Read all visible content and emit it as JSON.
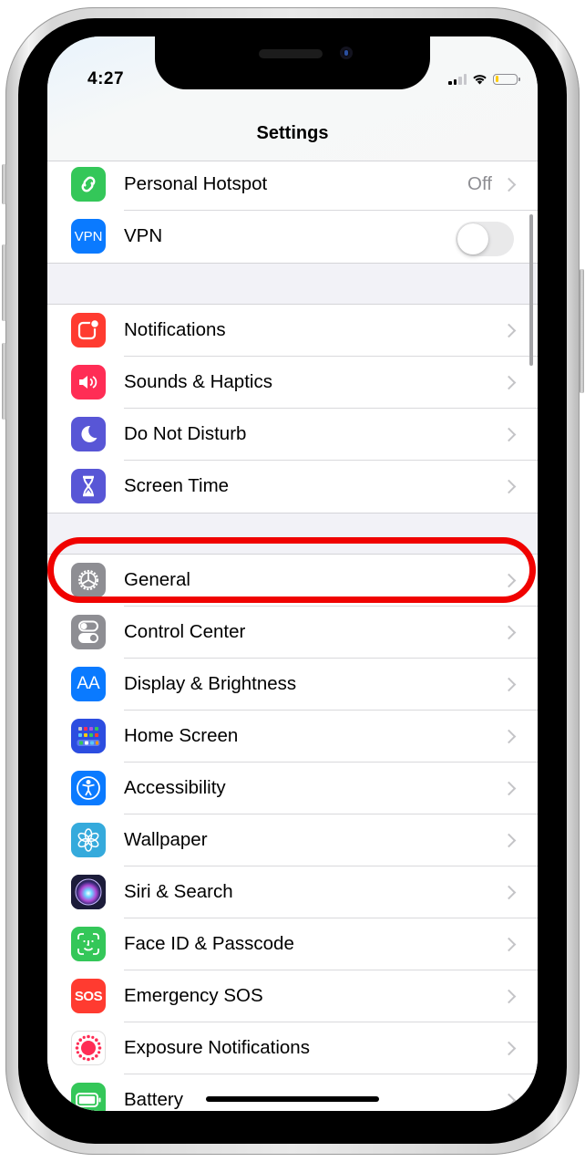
{
  "status_bar": {
    "time": "4:27",
    "signal_bars_active": 2,
    "signal_bars_total": 4,
    "wifi": "connected",
    "battery_level_percent": 15,
    "battery_color": "#ffcc00"
  },
  "nav": {
    "title": "Settings"
  },
  "groups": [
    {
      "rows": [
        {
          "label": "Personal Hotspot",
          "icon": "personal-hotspot-icon",
          "icon_color": "#34c759",
          "value": "Off",
          "accessory": "chevron"
        },
        {
          "label": "VPN",
          "icon": "vpn-icon",
          "icon_color": "#0a7aff",
          "icon_text": "VPN",
          "accessory": "toggle",
          "toggle_on": false
        }
      ]
    },
    {
      "rows": [
        {
          "label": "Notifications",
          "icon": "notifications-icon",
          "icon_color": "#ff3b30",
          "accessory": "chevron"
        },
        {
          "label": "Sounds & Haptics",
          "icon": "speaker-icon",
          "icon_color": "#ff2d55",
          "accessory": "chevron"
        },
        {
          "label": "Do Not Disturb",
          "icon": "moon-icon",
          "icon_color": "#5856d6",
          "accessory": "chevron"
        },
        {
          "label": "Screen Time",
          "icon": "hourglass-icon",
          "icon_color": "#5856d6",
          "accessory": "chevron"
        }
      ]
    },
    {
      "rows": [
        {
          "label": "General",
          "icon": "gear-icon",
          "icon_color": "#8e8e93",
          "accessory": "chevron",
          "highlighted": true
        },
        {
          "label": "Control Center",
          "icon": "switches-icon",
          "icon_color": "#8e8e93",
          "accessory": "chevron"
        },
        {
          "label": "Display & Brightness",
          "icon": "text-size-icon",
          "icon_color": "#0a7aff",
          "icon_text": "AA",
          "accessory": "chevron"
        },
        {
          "label": "Home Screen",
          "icon": "app-grid-icon",
          "icon_color": "#2c4de0",
          "accessory": "chevron"
        },
        {
          "label": "Accessibility",
          "icon": "accessibility-icon",
          "icon_color": "#0a7aff",
          "accessory": "chevron"
        },
        {
          "label": "Wallpaper",
          "icon": "flower-icon",
          "icon_color": "#35aadc",
          "accessory": "chevron"
        },
        {
          "label": "Siri & Search",
          "icon": "siri-icon",
          "icon_color": "#1c1c3a",
          "accessory": "chevron"
        },
        {
          "label": "Face ID & Passcode",
          "icon": "face-id-icon",
          "icon_color": "#34c759",
          "accessory": "chevron"
        },
        {
          "label": "Emergency SOS",
          "icon": "sos-icon",
          "icon_color": "#ff3b30",
          "icon_text": "SOS",
          "accessory": "chevron"
        },
        {
          "label": "Exposure Notifications",
          "icon": "exposure-icon",
          "icon_color": "#ffffff",
          "accessory": "chevron"
        },
        {
          "label": "Battery",
          "icon": "battery-icon",
          "icon_color": "#34c759",
          "accessory": "chevron"
        }
      ]
    }
  ],
  "annotation": {
    "highlight_color": "#f00200",
    "target": "General"
  }
}
